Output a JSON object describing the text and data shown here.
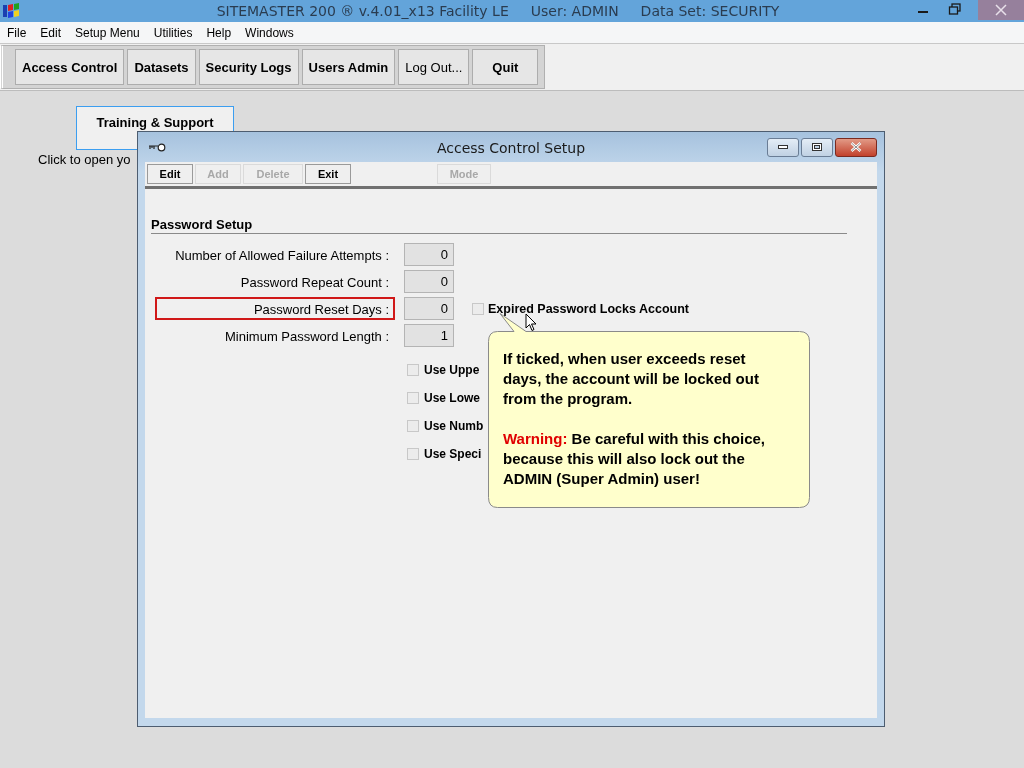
{
  "window": {
    "title": "SITEMASTER 200 ® v.4.01_x13 Facility LE",
    "user": "User: ADMIN",
    "data_set": "Data Set: SECURITY"
  },
  "menu": [
    "File",
    "Edit",
    "Setup Menu",
    "Utilities",
    "Help",
    "Windows"
  ],
  "toolbar": [
    {
      "label": "Access Control",
      "bold": true
    },
    {
      "label": "Datasets",
      "bold": true
    },
    {
      "label": "Security Logs",
      "bold": true
    },
    {
      "label": "Users Admin",
      "bold": true
    },
    {
      "label": "Log Out...",
      "bold": false
    },
    {
      "label": "Quit",
      "bold": true
    }
  ],
  "training": {
    "button": "Training & Support",
    "hint": "Click to open yo"
  },
  "dialog": {
    "title": "Access Control Setup",
    "buttons": [
      {
        "label": "Edit",
        "disabled": false
      },
      {
        "label": "Add",
        "disabled": true
      },
      {
        "label": "Delete",
        "disabled": true
      },
      {
        "label": "Exit",
        "disabled": false
      }
    ],
    "mode_button": {
      "label": "Mode",
      "disabled": true
    },
    "section": "Password Setup",
    "fields": [
      {
        "label": "Number of Allowed Failure Attempts :",
        "value": "0",
        "highlighted": false
      },
      {
        "label": "Password Repeat Count :",
        "value": "0",
        "highlighted": false
      },
      {
        "label": "Password Reset Days :",
        "value": "0",
        "highlighted": true
      },
      {
        "label": "Minimum Password Length :",
        "value": "1",
        "highlighted": false
      }
    ],
    "expired": {
      "label": "Expired Password Locks Account",
      "checked": false
    },
    "options": [
      {
        "label": "Use Uppe",
        "checked": false
      },
      {
        "label": "Use Lowe",
        "checked": false
      },
      {
        "label": "Use Numb",
        "checked": false
      },
      {
        "label": "Use Speci",
        "checked": false
      }
    ]
  },
  "tooltip": {
    "text": "If ticked, when user exceeds reset days, the account will be locked out from the program.",
    "warning_label": "Warning:",
    "warning_text": "Be careful with this choice, because this will also lock out the ADMIN (Super Admin) user!"
  }
}
